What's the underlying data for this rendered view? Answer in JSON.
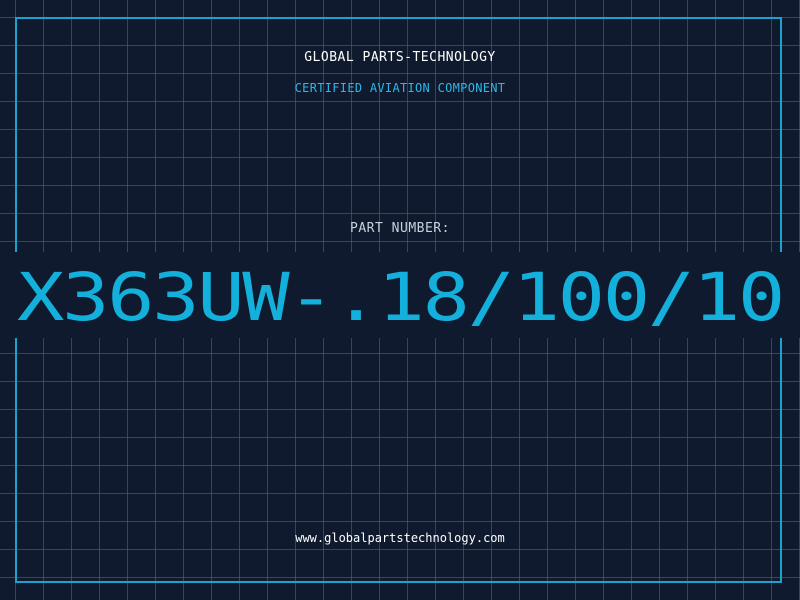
{
  "header": {
    "company": "GLOBAL PARTS-TECHNOLOGY",
    "tagline": "CERTIFIED AVIATION COMPONENT"
  },
  "part": {
    "label": "PART NUMBER:",
    "number": "X363UW-.18/100/10"
  },
  "footer": {
    "website": "www.globalpartstechnology.com"
  },
  "colors": {
    "background": "#101a2e",
    "grid": "#32789a",
    "accent": "#1aa3cc",
    "part_number": "#14b0dc",
    "text": "#ffffff"
  }
}
